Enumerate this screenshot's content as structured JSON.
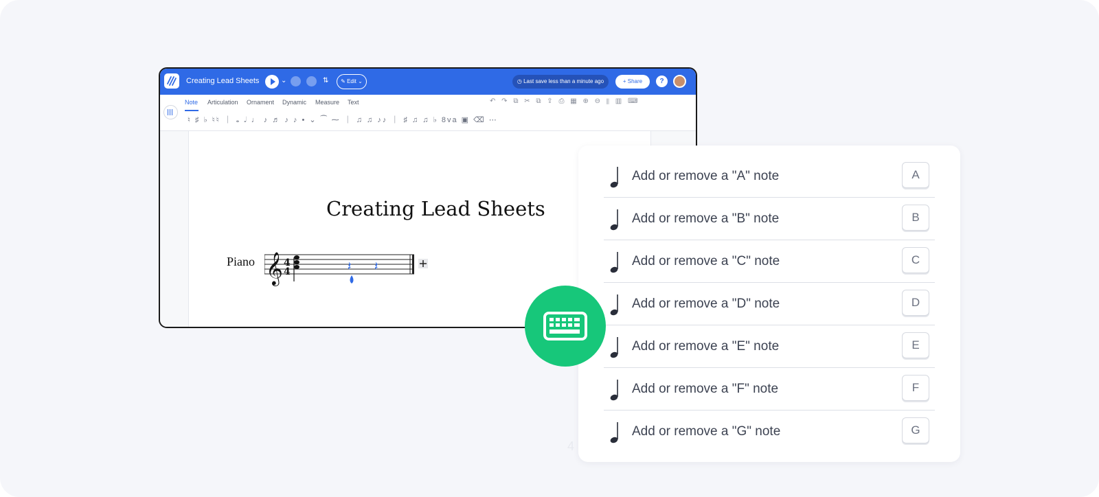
{
  "app": {
    "doc_title": "Creating Lead Sheets",
    "edit_label": "Edit",
    "last_save": "Last save less than a minute ago",
    "share_label": "Share",
    "help_label": "?"
  },
  "ribbon": {
    "tabs": [
      "Note",
      "Articulation",
      "Ornament",
      "Dynamic",
      "Measure",
      "Text"
    ],
    "active_tab": "Note"
  },
  "score": {
    "title": "Creating Lead Sheets",
    "instrument": "Piano",
    "time_signature_top": "4",
    "time_signature_bottom": "4"
  },
  "shortcuts": [
    {
      "label": "Add or remove a \"A\" note",
      "key": "A"
    },
    {
      "label": "Add or remove a \"B\" note",
      "key": "B"
    },
    {
      "label": "Add or remove a \"C\" note",
      "key": "C"
    },
    {
      "label": "Add or remove a \"D\" note",
      "key": "D"
    },
    {
      "label": "Add or remove a \"E\" note",
      "key": "E"
    },
    {
      "label": "Add or remove a \"F\" note",
      "key": "F"
    },
    {
      "label": "Add or remove a \"G\" note",
      "key": "G"
    }
  ],
  "page_number": "4",
  "colors": {
    "primary_blue": "#2f6ae6",
    "badge_green": "#17c77a",
    "background": "#f5f6fa"
  },
  "icons": {
    "logo": "flat-logo-icon",
    "badge": "keyboard-icon",
    "row_icon": "quarter-note-icon"
  }
}
